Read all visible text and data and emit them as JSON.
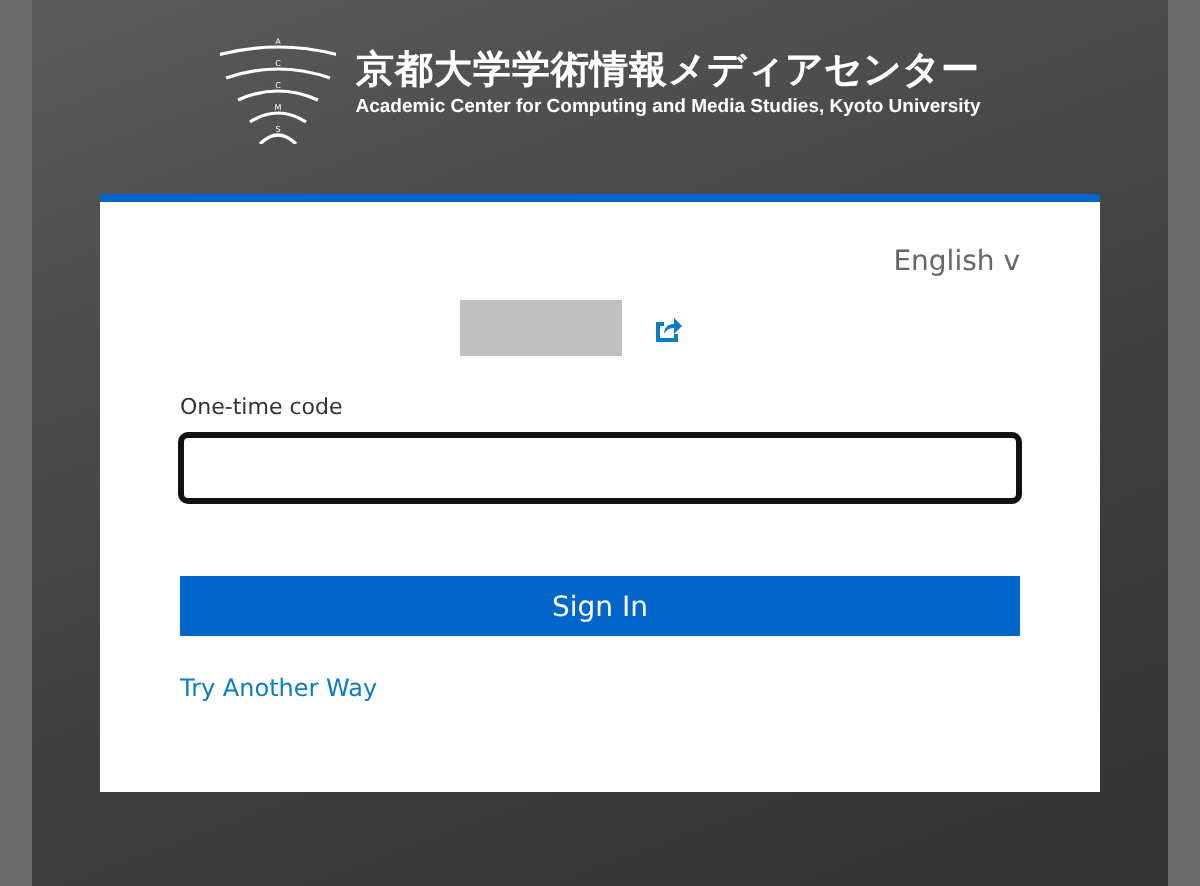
{
  "header": {
    "logo_letters": [
      "A",
      "C",
      "C",
      "M",
      "S"
    ],
    "title_ja": "京都大学学術情報メディアセンター",
    "title_en": "Academic Center for Computing and Media Studies, Kyoto University"
  },
  "language": {
    "label": "English",
    "caret": "v"
  },
  "form": {
    "label": "One-time code",
    "focused": true,
    "submit": "Sign In",
    "alt_link": "Try Another Way"
  }
}
